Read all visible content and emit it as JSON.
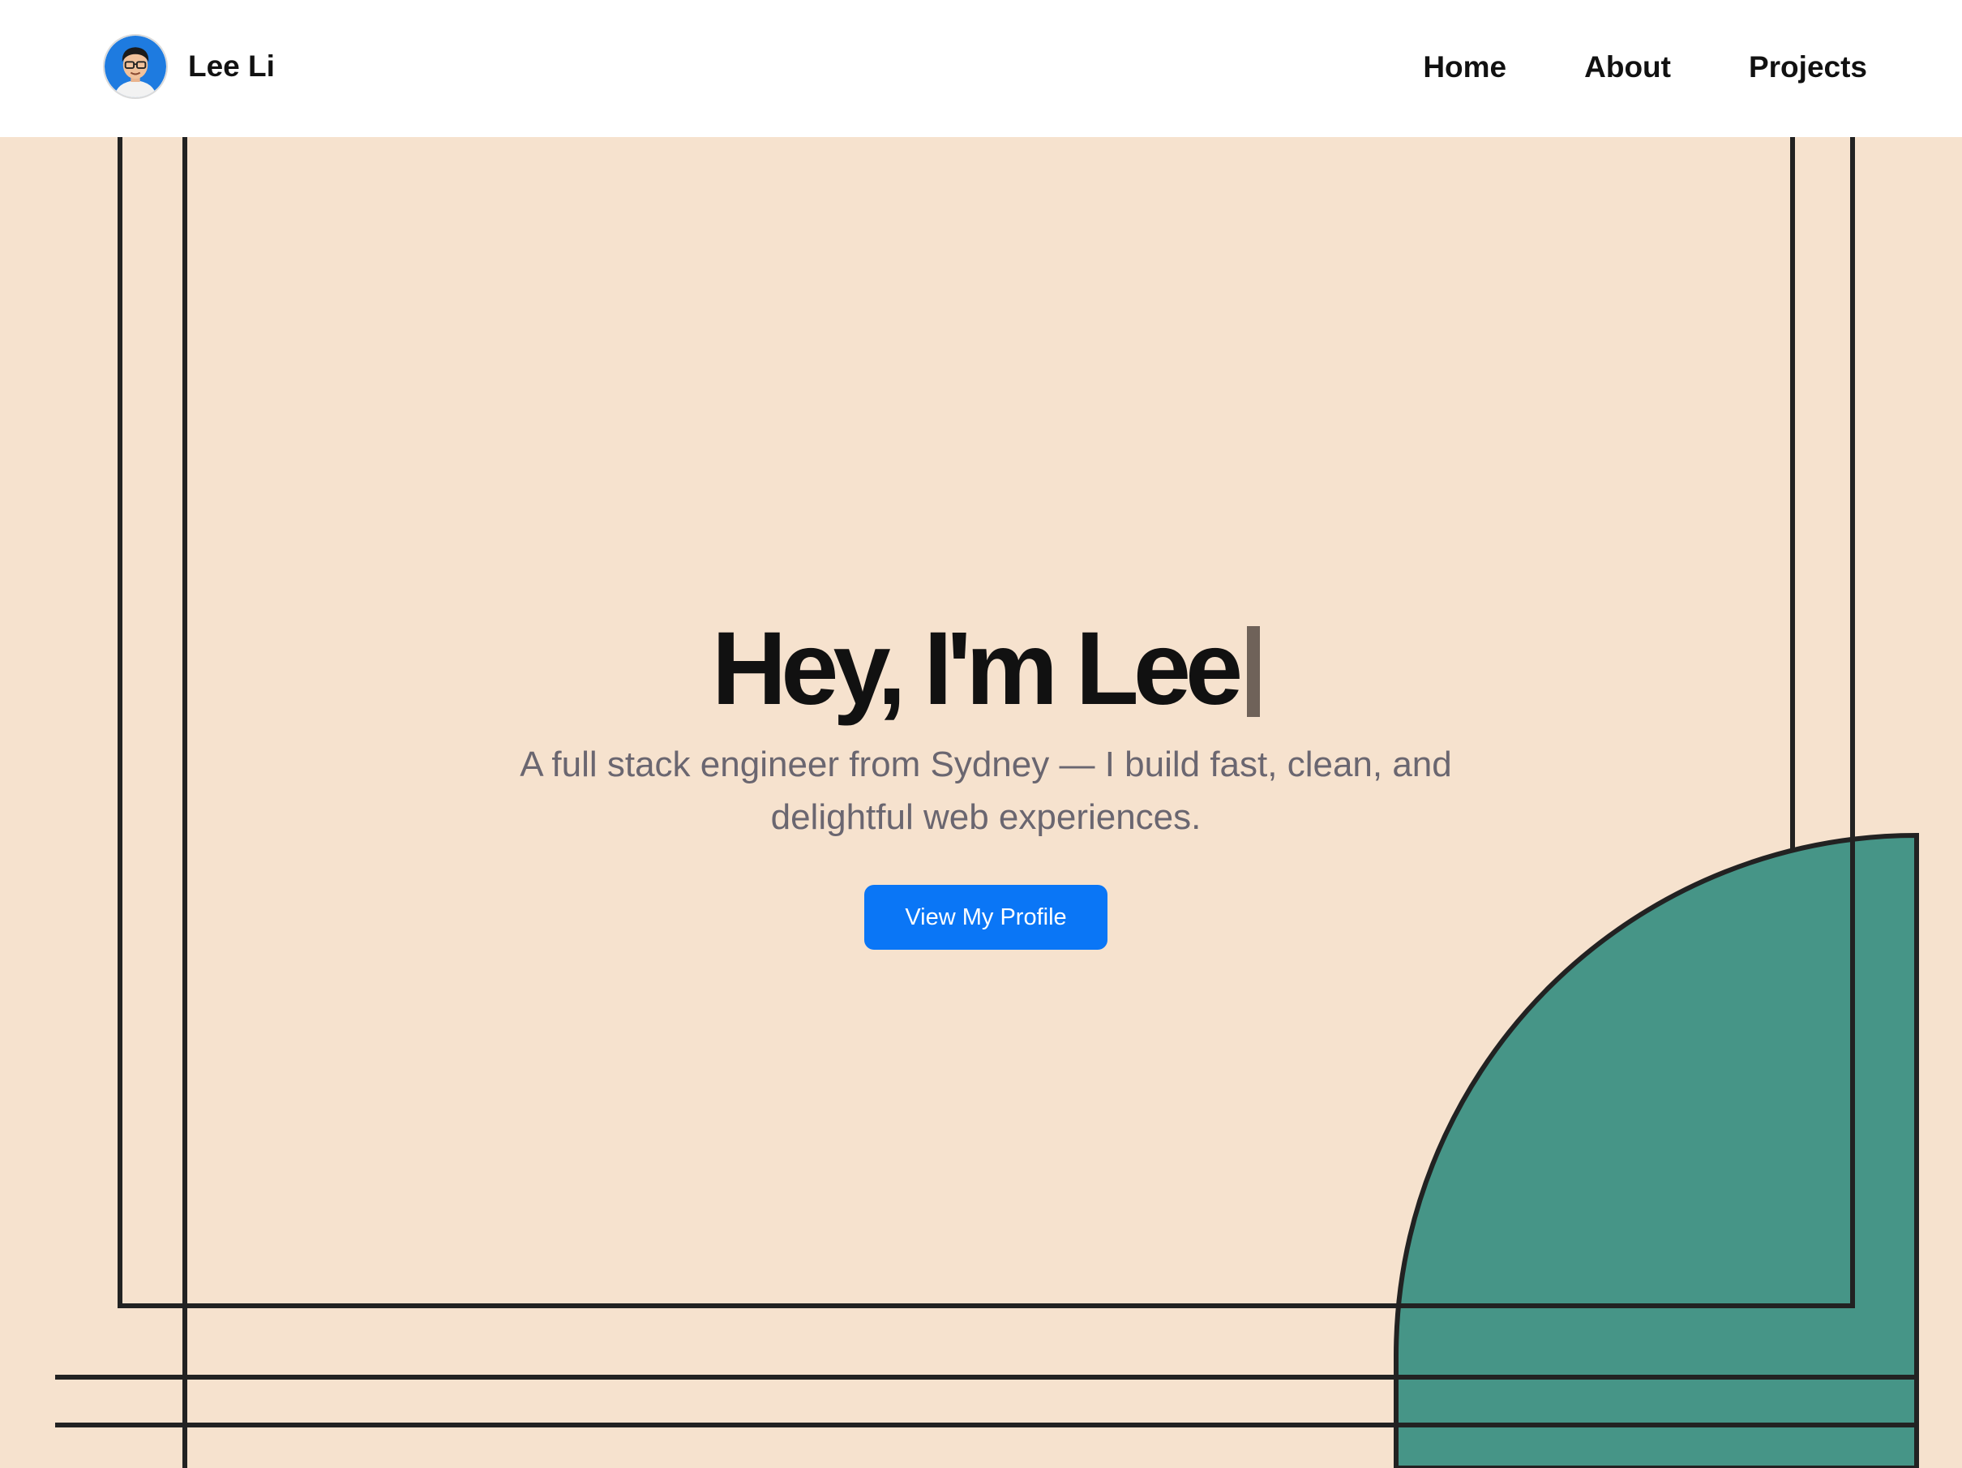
{
  "header": {
    "brand_name": "Lee Li",
    "avatar_icon": "developer-avatar-icon",
    "nav": [
      {
        "label": "Home"
      },
      {
        "label": "About"
      },
      {
        "label": "Projects"
      }
    ]
  },
  "hero": {
    "title": "Hey, I'm Lee",
    "subtitle": "A full stack engineer from Sydney — I build fast, clean, and delightful web experiences.",
    "cta_label": "View My Profile"
  },
  "colors": {
    "background": "#F6E2CE",
    "header_background": "#FFFFFF",
    "accent_button": "#0A76F6",
    "decor_circle": "#469587",
    "decor_lines": "#222222",
    "text_dark": "#111111",
    "text_muted": "#6A6670",
    "cursor": "#6F6259"
  }
}
